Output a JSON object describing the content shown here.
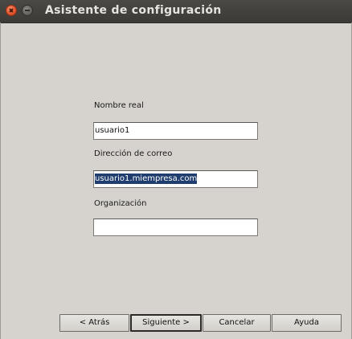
{
  "window": {
    "title": "Asistente de configuración"
  },
  "form": {
    "real_name": {
      "label": "Nombre real",
      "value": "usuario1"
    },
    "email": {
      "label": "Dirección de correo",
      "value": "usuario1.miempresa.com"
    },
    "organization": {
      "label": "Organización",
      "value": ""
    }
  },
  "buttons": {
    "back": "< Atrás",
    "next": "Siguiente >",
    "cancel": "Cancelar",
    "help": "Ayuda"
  },
  "colors": {
    "dialog_bg": "#d6d2cd",
    "titlebar_bg": "#3b3a36",
    "selection_bg": "#1f3d6e",
    "close_button": "#e4532d"
  }
}
